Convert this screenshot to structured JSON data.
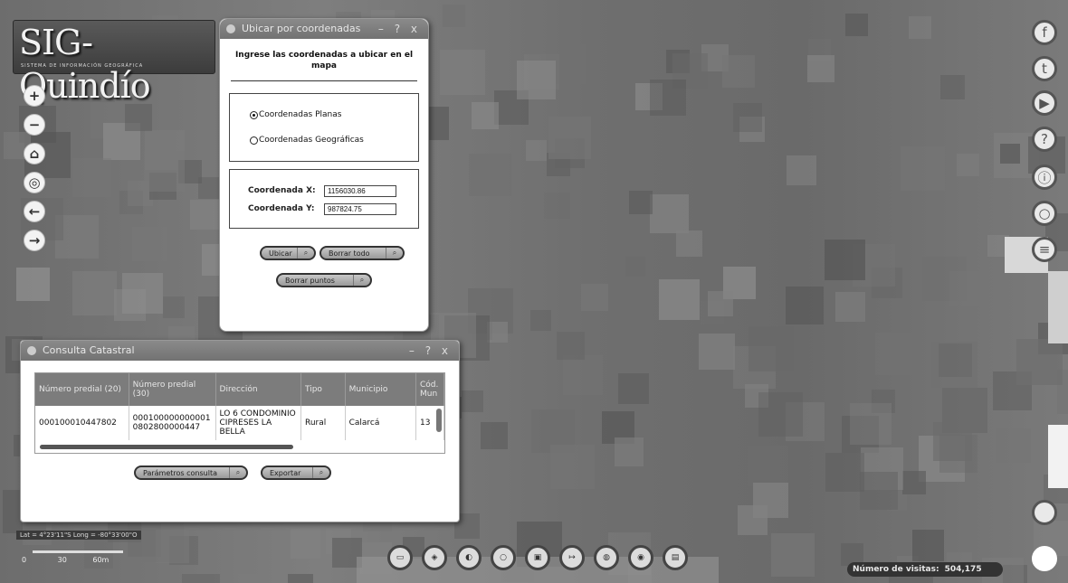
{
  "logo": {
    "title": "SIG-Quindío",
    "subtitle": "SISTEMA DE INFORMACIÓN GEOGRÁFICA"
  },
  "map_nav": [
    "+",
    "−",
    "⌂",
    "◎",
    "←",
    "→"
  ],
  "social": [
    "f",
    "t",
    "▶",
    "?",
    "ⓘ",
    "○",
    "≡"
  ],
  "coord_window": {
    "title": "Ubicar por coordenadas",
    "controls": "– ? x",
    "heading": "Ingrese las coordenadas a ubicar en el mapa",
    "radio_planas": "Coordenadas Planas",
    "radio_geograficas": "Coordenadas Geográficas",
    "label_x": "Coordenada X:",
    "value_x": "1156030.86",
    "label_y": "Coordenada Y:",
    "value_y": "987824.75",
    "btn_ubicar": "Ubicar",
    "btn_borrar_todo": "Borrar todo",
    "btn_borrar_puntos": "Borrar puntos"
  },
  "catastral_window": {
    "title": "Consulta Catastral",
    "controls": "– ? x",
    "columns": [
      "Número predial (20)",
      "Número predial (30)",
      "Dirección",
      "Tipo",
      "Municipio",
      "Cód. Mun"
    ],
    "row": [
      "000100010447802",
      "0001000000000010802800000447",
      "LO 6 CONDOMINIO CIPRESES LA BELLA",
      "Rural",
      "Calarcá",
      "13"
    ],
    "btn_parametros": "Parámetros consulta",
    "btn_exportar": "Exportar"
  },
  "coords_readout": "Lat = 4°23'11\"S Long = -80°33'00\"O",
  "scale": {
    "zero": "0",
    "mid": "30",
    "end": "60m"
  },
  "toolbar_icons": [
    "ruler-icon",
    "layers-icon",
    "globe-icon",
    "circle-icon",
    "print-icon",
    "arrow-icon",
    "earth-icon",
    "eye-icon",
    "doc-icon"
  ],
  "visits": {
    "label": "Número de visitas:",
    "value": "504,175"
  },
  "colors": {
    "window_title": "#7a7a7a",
    "map_gray": "#7a7a7a"
  }
}
